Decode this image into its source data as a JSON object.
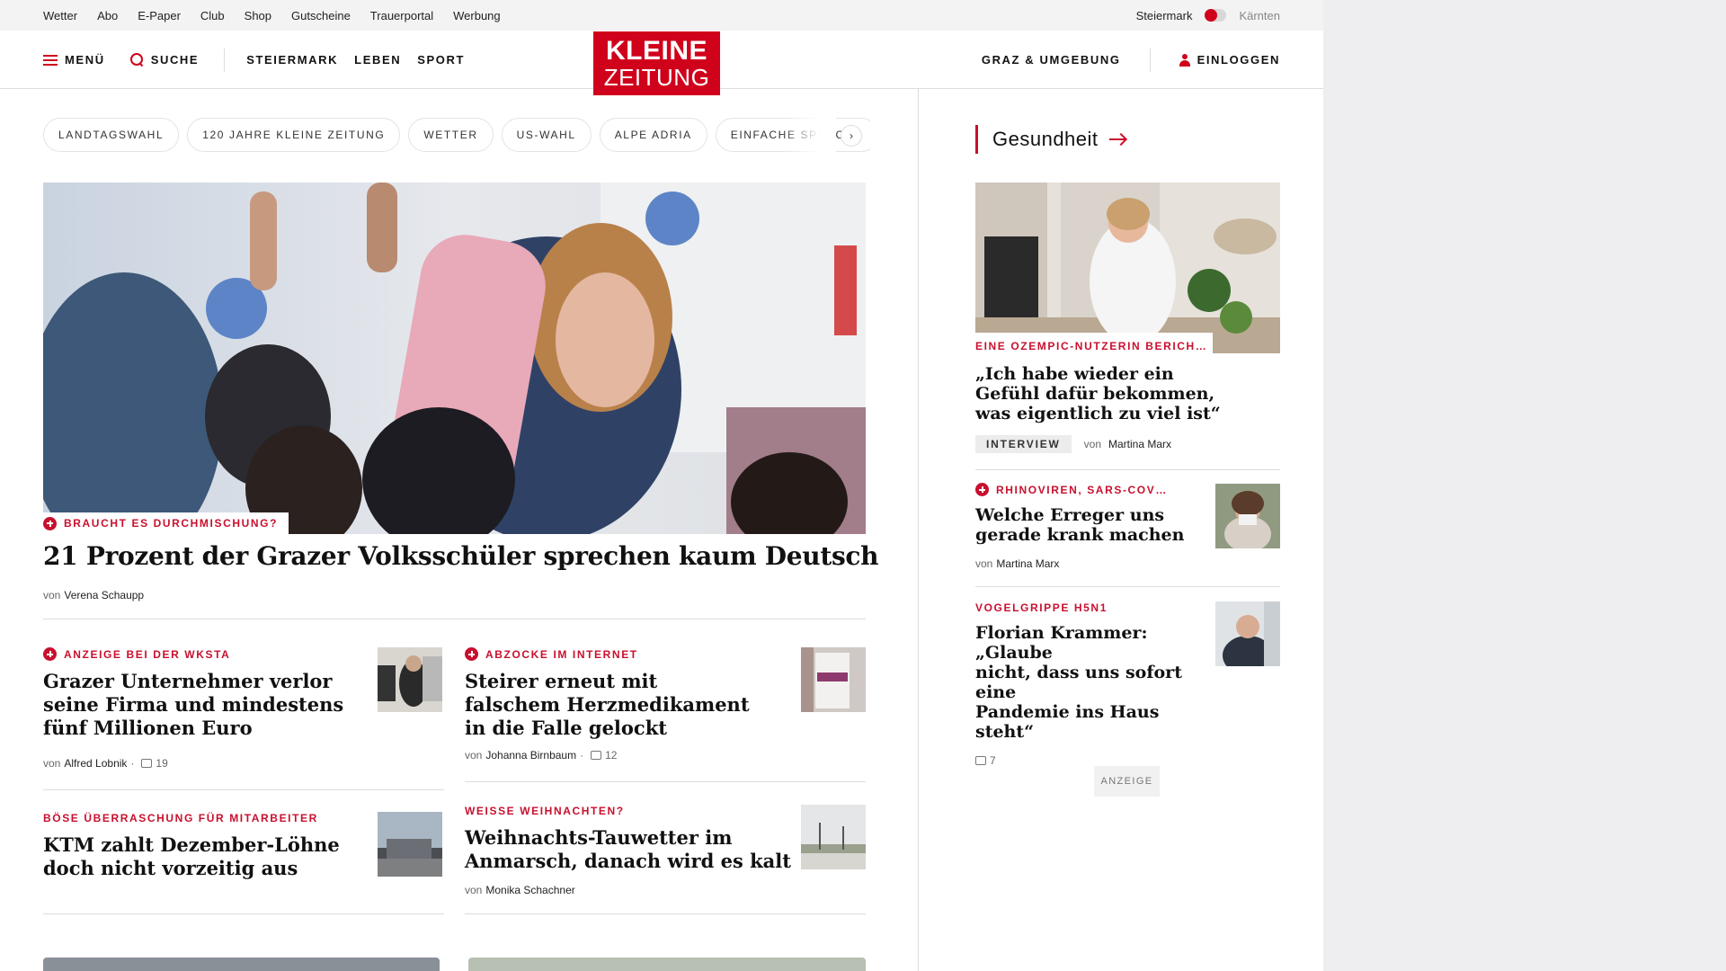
{
  "utility_bar": {
    "links": [
      "Wetter",
      "Abo",
      "E-Paper",
      "Club",
      "Shop",
      "Gutscheine",
      "Trauerportal",
      "Werbung"
    ],
    "region_active": "Steiermark",
    "region_inactive": "Kärnten"
  },
  "header": {
    "menu_label": "MENÜ",
    "search_label": "SUCHE",
    "nav": [
      "STEIERMARK",
      "LEBEN",
      "SPORT"
    ],
    "logo_line1": "KLEINE",
    "logo_line2": "ZEITUNG",
    "region_link": "GRAZ & UMGEBUNG",
    "login_label": "EINLOGGEN"
  },
  "chips": [
    "LANDTAGSWAHL",
    "120 JAHRE KLEINE ZEITUNG",
    "WETTER",
    "US-WAHL",
    "ALPE ADRIA",
    "EINFACHE SPRACHE"
  ],
  "chip_next": "›",
  "hero": {
    "kicker": "BRAUCHT ES DURCHMISCHUNG?",
    "title": "21 Prozent der Grazer Volksschüler sprechen kaum Deutsch",
    "by": "von",
    "author": "Verena Schaupp"
  },
  "teasers": [
    {
      "kicker": "ANZEIGE BEI DER WKSTA",
      "plus": true,
      "title_lines": [
        "Grazer Unternehmer verlor",
        "seine Firma und mindestens",
        "fünf Millionen Euro"
      ],
      "by": "von",
      "author": "Alfred Lobnik",
      "comments": "19"
    },
    {
      "kicker": "ABZOCKE IM INTERNET",
      "plus": true,
      "title_lines": [
        "Steirer erneut mit",
        "falschem Herzmedikament",
        "in die Falle gelockt"
      ],
      "by": "von",
      "author": "Johanna Birnbaum",
      "comments": "12"
    },
    {
      "kicker": "BÖSE ÜBERRASCHUNG FÜR MITARBEITER",
      "plus": false,
      "title_lines": [
        "KTM zahlt Dezember-Löhne",
        "doch nicht vorzeitig aus"
      ],
      "by": "",
      "author": "",
      "comments": ""
    },
    {
      "kicker": "WEISSE WEIHNACHTEN?",
      "plus": false,
      "title_lines": [
        "Weihnachts-Tauwetter im",
        "Anmarsch, danach wird es kalt"
      ],
      "by": "von",
      "author": "Monika Schachner",
      "comments": ""
    }
  ],
  "sidebar": {
    "heading": "Gesundheit",
    "lead": {
      "kicker": "EINE OZEMPIC-NUTZERIN BERICH…",
      "title_lines": [
        "„Ich habe wieder ein",
        "Gefühl dafür bekommen,",
        "was eigentlich zu viel ist“"
      ],
      "badge": "INTERVIEW",
      "by": "von",
      "author": "Martina Marx"
    },
    "items": [
      {
        "kicker": "RHINOVIREN, SARS-COV…",
        "plus": true,
        "title_lines": [
          "Welche Erreger uns",
          "gerade krank machen"
        ],
        "by": "von",
        "author": "Martina Marx",
        "comments": ""
      },
      {
        "kicker": "VOGELGRIPPE H5N1",
        "plus": false,
        "title_lines": [
          "Florian Krammer: „Glaube",
          "nicht, dass uns sofort eine",
          "Pandemie ins Haus steht“"
        ],
        "by": "",
        "author": "",
        "comments": "7"
      }
    ],
    "ad_label": "ANZEIGE"
  },
  "colors": {
    "brand_red": "#d0021b",
    "kicker_red": "#c8102e"
  }
}
